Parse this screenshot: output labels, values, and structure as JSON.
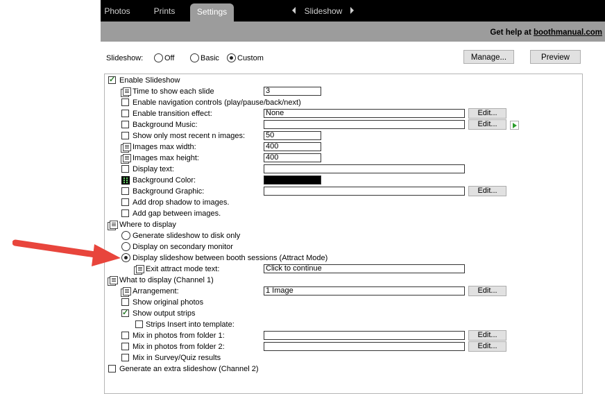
{
  "tabs": [
    {
      "label": "Photos",
      "active": false
    },
    {
      "label": "Prints",
      "active": false
    },
    {
      "label": "Settings",
      "active": true
    }
  ],
  "section_nav": {
    "label": "Slideshow"
  },
  "help": {
    "prefix": "Get help at ",
    "link": "boothmanual.com"
  },
  "mode": {
    "label": "Slideshow:",
    "options": [
      "Off",
      "Basic",
      "Custom"
    ],
    "selected": "Custom",
    "manage_button": "Manage...",
    "preview_button": "Preview"
  },
  "edit_label": "Edit...",
  "settings": {
    "enable_slideshow": {
      "label": "Enable Slideshow",
      "checked": true
    },
    "time_each": {
      "label": "Time to show each slide",
      "value": "3"
    },
    "nav_controls": {
      "label": "Enable navigation controls  (play/pause/back/next)",
      "checked": false
    },
    "transition": {
      "label": "Enable transition effect:",
      "checked": false,
      "value": "None"
    },
    "bg_music": {
      "label": "Background Music:",
      "checked": false,
      "value": ""
    },
    "recent_n": {
      "label": "Show only most recent n images:",
      "checked": false,
      "value": "50"
    },
    "max_width": {
      "label": "Images max width:",
      "value": "400"
    },
    "max_height": {
      "label": "Images max height:",
      "value": "400"
    },
    "display_text": {
      "label": "Display text:",
      "checked": false,
      "value": ""
    },
    "bg_color": {
      "label": "Background Color:",
      "value": "#000000"
    },
    "bg_graphic": {
      "label": "Background Graphic:",
      "checked": false,
      "value": ""
    },
    "drop_shadow": {
      "label": "Add drop shadow to images.",
      "checked": false
    },
    "add_gap": {
      "label": "Add gap between images.",
      "checked": false
    }
  },
  "where": {
    "label": "Where to display",
    "options": [
      "Generate slideshow to disk only",
      "Display on secondary monitor",
      "Display slideshow between booth sessions (Attract Mode)"
    ],
    "selected_index": 2,
    "exit_text": {
      "label": "Exit attract mode text:",
      "value": "Click to continue"
    }
  },
  "what": {
    "label": "What to display (Channel 1)",
    "arrangement": {
      "label": "Arrangement:",
      "value": "1 Image"
    },
    "show_original": {
      "label": "Show original photos",
      "checked": false
    },
    "show_strips": {
      "label": "Show output strips",
      "checked": true
    },
    "strips_insert": {
      "label": "Strips Insert into template:",
      "checked": false
    },
    "mix1": {
      "label": "Mix in photos from folder 1:",
      "checked": false,
      "value": ""
    },
    "mix2": {
      "label": "Mix in photos from folder 2:",
      "checked": false,
      "value": ""
    },
    "mix_survey": {
      "label": "Mix in Survey/Quiz results",
      "checked": false
    }
  },
  "extra_slideshow": {
    "label": "Generate an extra slideshow (Channel 2)",
    "checked": false
  },
  "colors": {
    "arrow": "#e8453c",
    "topbar": "#000000",
    "helpbar": "#9c9c9c"
  }
}
